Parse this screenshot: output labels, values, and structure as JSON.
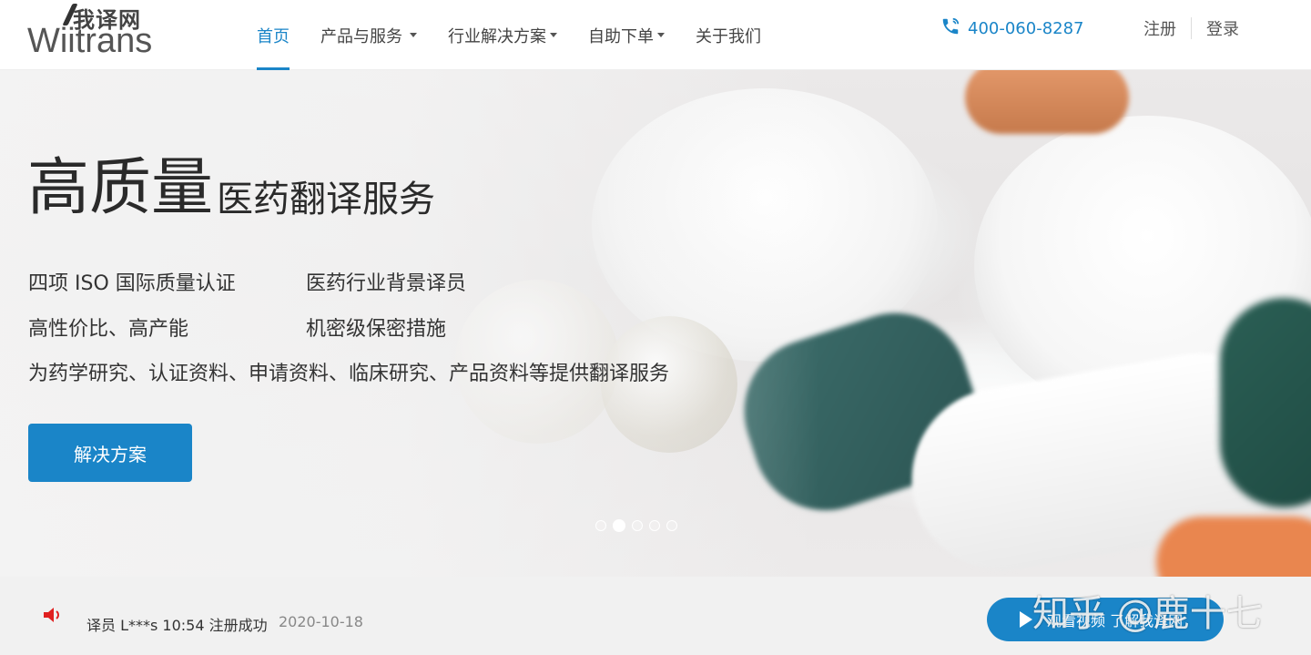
{
  "header": {
    "logo_cn": "我译网",
    "logo_en": "Wiitrans",
    "nav": [
      {
        "label": "首页",
        "dropdown": false,
        "active": true
      },
      {
        "label": "产品与服务",
        "dropdown": true,
        "active": false
      },
      {
        "label": "行业解决方案",
        "dropdown": true,
        "active": false
      },
      {
        "label": "自助下单",
        "dropdown": true,
        "active": false
      },
      {
        "label": "关于我们",
        "dropdown": false,
        "active": false
      }
    ],
    "phone": "400-060-8287",
    "register": "注册",
    "login": "登录"
  },
  "hero": {
    "title_big": "高质量",
    "title_small": "医药翻译服务",
    "features": [
      "四项 ISO 国际质量认证",
      "医药行业背景译员",
      "高性价比、高产能",
      "机密级保密措施",
      "为药学研究、认证资料、申请资料、临床研究、产品资料等提供翻译服务"
    ],
    "cta_label": "解决方案",
    "carousel_count": 5,
    "carousel_active": 2
  },
  "bottom": {
    "notice": "译员 L***s 10:54 注册成功",
    "date": "2020-10-18",
    "video_label": "观看视频 了解我译网",
    "watermark": "知乎 @鹿十七"
  },
  "colors": {
    "brand_blue": "#1a85c8",
    "alert_red": "#e02020"
  },
  "icons": {
    "phone": "phone-icon",
    "speaker": "speaker-icon",
    "play": "play-icon"
  }
}
